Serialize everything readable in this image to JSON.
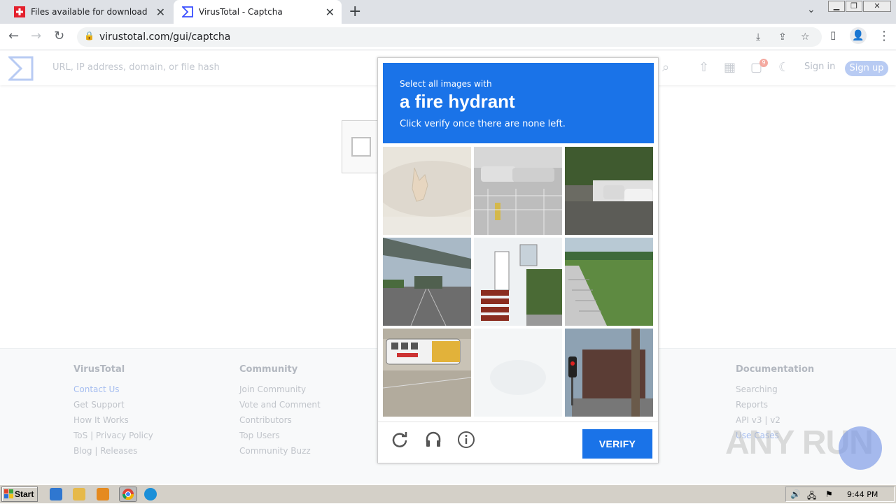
{
  "browser": {
    "tabs": [
      {
        "title": "Files available for download",
        "close": "✕"
      },
      {
        "title": "VirusTotal - Captcha",
        "close": "✕"
      }
    ],
    "new_tab": "+",
    "url": "virustotal.com/gui/captcha"
  },
  "vt": {
    "search_placeholder": "URL, IP address, domain, or file hash",
    "notification_count": "9",
    "signin": "Sign in",
    "signup": "Sign up",
    "footer": [
      {
        "heading": "VirusTotal",
        "links": [
          "Contact Us",
          "Get Support",
          "How It Works",
          "ToS | Privacy Policy",
          "Blog | Releases"
        ]
      },
      {
        "heading": "Community",
        "links": [
          "Join Community",
          "Vote and Comment",
          "Contributors",
          "Top Users",
          "Community Buzz"
        ]
      },
      {
        "heading": "Documentation",
        "links": [
          "Searching",
          "Reports",
          "API v3 | v2",
          "Use Cases"
        ]
      }
    ]
  },
  "captcha": {
    "prompt_pre": "Select all images with",
    "prompt_main": "a fire hydrant",
    "prompt_post": "Click verify once there are none left.",
    "verify_label": "VERIFY",
    "tiles": [
      "cat on sand",
      "parking lot cars",
      "street parked cars",
      "highway overpass",
      "house steps",
      "grass stairs",
      "school bus",
      "blank faded",
      "traffic light building"
    ],
    "colors": {
      "header": "#1a73e8",
      "button": "#1a73e8"
    }
  },
  "watermark": "ANY RUN",
  "taskbar": {
    "start": "Start",
    "clock": "9:44 PM"
  }
}
